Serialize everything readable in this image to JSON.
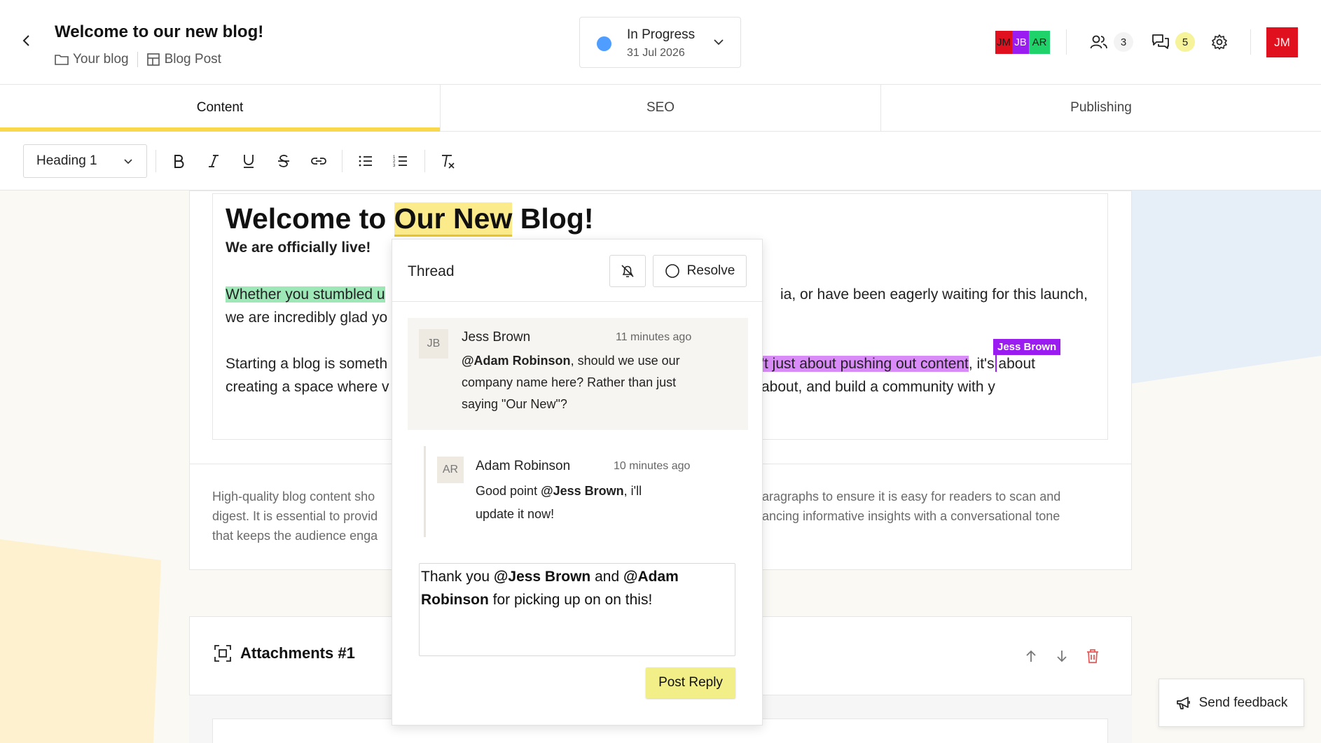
{
  "header": {
    "title": "Welcome to our new blog!",
    "breadcrumbs": [
      {
        "label": "Your blog",
        "icon": "folder-icon"
      },
      {
        "label": "Blog Post",
        "icon": "layout-icon"
      }
    ],
    "status": {
      "label": "In Progress",
      "date": "31 Jul 2026",
      "color": "#4f9dff"
    },
    "collaborators": [
      {
        "initials": "JM",
        "color": "#e0101e",
        "text_color": "#1a1a1a"
      },
      {
        "initials": "JB",
        "color": "#9b1cf0",
        "text_color": "#ffffff"
      },
      {
        "initials": "AR",
        "color": "#1fd36a",
        "text_color": "#1a1a1a"
      }
    ],
    "users_count": "3",
    "comments_count": "5",
    "user_initials": "JM"
  },
  "tabs": [
    {
      "label": "Content",
      "active": true
    },
    {
      "label": "SEO",
      "active": false
    },
    {
      "label": "Publishing",
      "active": false
    }
  ],
  "toolbar": {
    "block_type": "Heading 1",
    "buttons": [
      "bold-icon",
      "italic-icon",
      "underline-icon",
      "strikethrough-icon",
      "link-icon",
      "bullet-list-icon",
      "numbered-list-icon",
      "clear-format-icon"
    ]
  },
  "editor": {
    "title_before": "Welcome to ",
    "title_highlight": "Our New",
    "title_after": " Blog!",
    "subtitle": "We are officially live!",
    "p1_line1_highlight": "Whether you stumbled u",
    "p1_line1_right": "ia, or have been eagerly waiting for this launch,",
    "p1_line2": "we are incredibly glad yo",
    "p2_line1_left": "Starting a blog is someth",
    "p2_line1_highlight": "'t just about pushing out content",
    "p2_line1_after": ", it's about",
    "p2_line2_left": "creating a space where v",
    "p2_line2_right": "about, and build a community with y",
    "cursor_user": "Jess Brown"
  },
  "hint": {
    "line1_left": "High-quality blog content sho",
    "line1_right": "aragraphs to ensure it is easy for readers to scan and",
    "line2_left": "digest. It is essential to provid",
    "line2_right": "ancing informative insights with a conversational tone",
    "line3_left": "that keeps the audience enga"
  },
  "attachments": {
    "title": "Attachments #1"
  },
  "thread": {
    "title": "Thread",
    "resolve_label": "Resolve",
    "comment": {
      "initials": "JB",
      "author": "Jess Brown",
      "time": "11 minutes ago",
      "mention": "@Adam Robinson",
      "text_line1": ", should we use our",
      "text_line2": "company name here? Rather than just",
      "text_line3": "saying \"Our New\"?"
    },
    "reply": {
      "initials": "AR",
      "author": "Adam Robinson",
      "time": "10 minutes ago",
      "text_before": "Good point ",
      "mention": "@Jess Brown",
      "text_after": ", i'll",
      "text_line2": "update it now!"
    },
    "draft": {
      "t1": "Thank you ",
      "m1": "@Jess Brown",
      "t2": " and ",
      "m2": "@Adam",
      "m3": "Robinson",
      "t3": " for picking up on on this!"
    },
    "post_label": "Post Reply"
  },
  "feedback": {
    "label": "Send feedback"
  }
}
